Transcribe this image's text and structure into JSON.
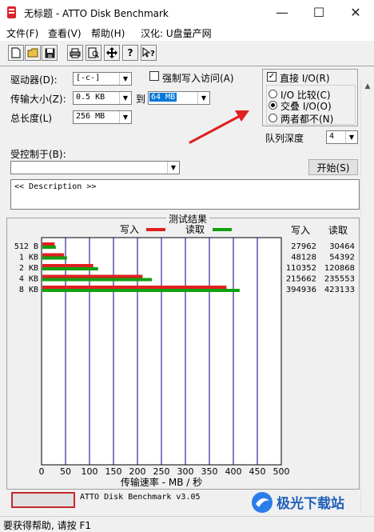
{
  "window": {
    "title": "无标题 - ATTO Disk Benchmark",
    "minimize": "—",
    "maximize": "☐",
    "close": "✕"
  },
  "menu": [
    "文件(F)",
    "查看(V)",
    "帮助(H)",
    "汉化: U盘量产网"
  ],
  "toolbar": {
    "icons": [
      "new-icon",
      "open-icon",
      "save-icon",
      "print-icon",
      "print-preview-icon",
      "move-icon",
      "help-icon",
      "context-help-icon"
    ]
  },
  "settings": {
    "drive_label": "驱动器(D):",
    "drive_value": "[-c-]",
    "force_write_label": "强制写入访问(A)",
    "transfer_label": "传输大小(Z):",
    "transfer_from": "0.5 KB",
    "to_label": "到",
    "transfer_to": "64 MB",
    "length_label": "总长度(L)",
    "length_value": "256 MB",
    "direct_io_label": "直接 I/O(R)",
    "direct_io_checked": true,
    "io_compare_label": "I/O 比较(C)",
    "overlapped_io_label": "交叠 I/O(O)",
    "neither_label": "两者都不(N)",
    "selected_mode": "overlapped_io",
    "queue_depth_label": "队列深度",
    "queue_depth_value": "4",
    "controlled_by_label": "受控制于(B):",
    "controlled_by_value": "",
    "start_button": "开始(S)",
    "description": "<< Description >>"
  },
  "results": {
    "title": "测试结果",
    "write_legend": "写入",
    "read_legend": "读取",
    "write_header": "写入",
    "read_header": "读取",
    "xlabel": "传输速率 - MB / 秒"
  },
  "chart_data": {
    "type": "bar",
    "orientation": "horizontal",
    "categories": [
      "512 B",
      "1 KB",
      "2 KB",
      "4 KB",
      "8 KB"
    ],
    "series": [
      {
        "name": "写入",
        "values": [
          27.3,
          47.0,
          107.8,
          210.6,
          385.7
        ],
        "raw": [
          27962,
          48128,
          110352,
          215662,
          394936
        ],
        "color": "#e02020"
      },
      {
        "name": "读取",
        "values": [
          29.7,
          53.1,
          118.0,
          230.0,
          413.2
        ],
        "raw": [
          30464,
          54392,
          120868,
          235553,
          423133
        ],
        "color": "#10a010"
      }
    ],
    "xlim": [
      0,
      500
    ],
    "xticks": [
      0,
      50,
      100,
      150,
      200,
      250,
      300,
      350,
      400,
      450,
      500
    ],
    "grid": true
  },
  "footer": {
    "version": "ATTO Disk Benchmark v3.05",
    "status": "要获得帮助, 请按 F1",
    "watermark": "极光下载站"
  }
}
